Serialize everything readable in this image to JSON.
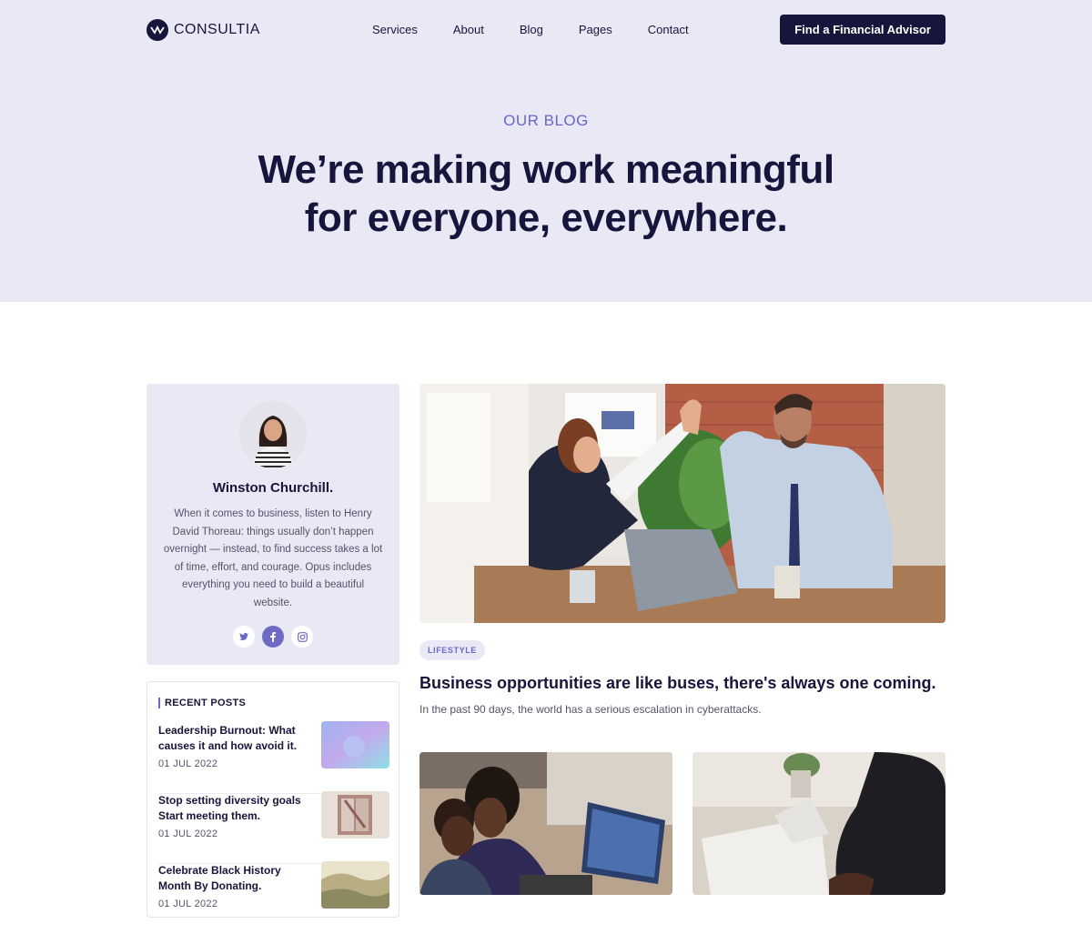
{
  "brand": {
    "name": "CONSULTIA"
  },
  "nav": {
    "links": [
      "Services",
      "About",
      "Blog",
      "Pages",
      "Contact"
    ],
    "cta_label": "Find a Financial Advisor"
  },
  "hero": {
    "eyebrow": "OUR BLOG",
    "headline_line1": "We’re making work meaningful",
    "headline_line2": "for everyone, everywhere."
  },
  "author": {
    "name": "Winston Churchill.",
    "bio": "When it comes to business, listen to Henry David Thoreau: things usually don’t happen overnight — instead, to find success takes a lot of time, effort, and courage. Opus includes everything you need to build a beautiful website.",
    "socials": [
      "twitter-icon",
      "facebook-icon",
      "instagram-icon"
    ]
  },
  "recent_posts": {
    "title": "RECENT POSTS",
    "items": [
      {
        "title": "Leadership Burnout: What causes it and how avoid it.",
        "date": "01 JUL 2022"
      },
      {
        "title": "Stop setting diversity goals Start meeting them.",
        "date": "01 JUL 2022"
      },
      {
        "title": "Celebrate Black History Month By Donating.",
        "date": "01 JUL 2022"
      }
    ]
  },
  "featured": {
    "tag": "LIFESTYLE",
    "title": "Business opportunities are like buses, there's always one coming.",
    "excerpt": "In the past 90 days, the world has a serious escalation in cyberattacks."
  },
  "colors": {
    "primary": "#17153b",
    "accent": "#6d66c6",
    "hero_bg": "#e9e8f5"
  }
}
